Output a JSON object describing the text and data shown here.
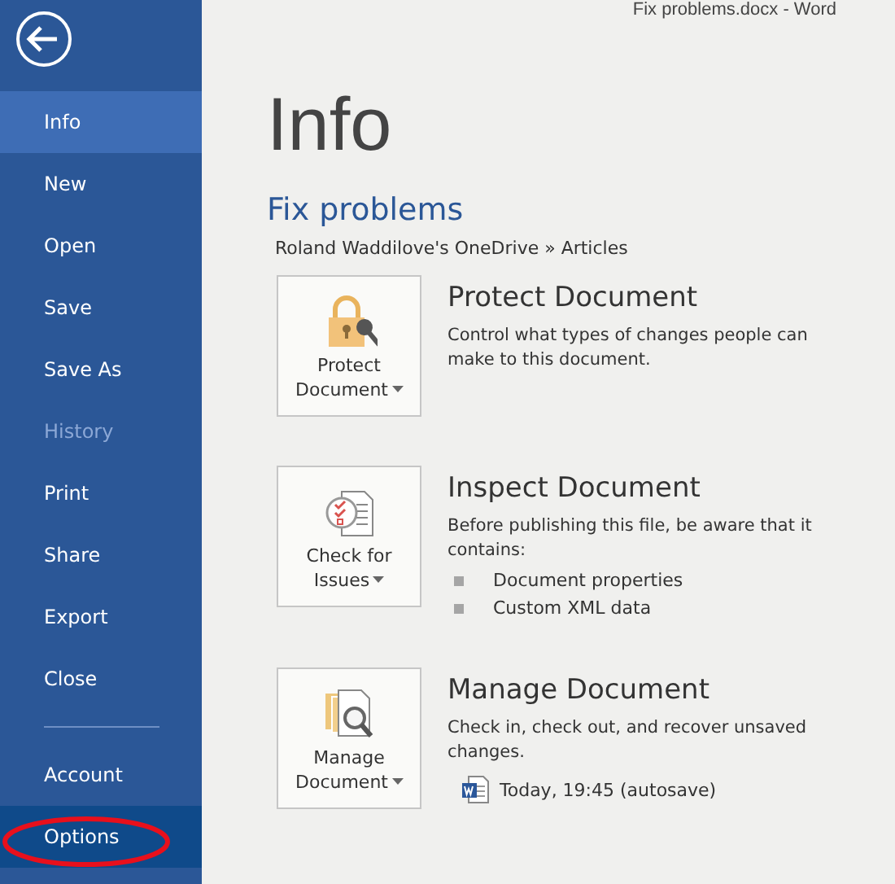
{
  "window": {
    "title": "Fix problems.docx - Word"
  },
  "sidebar": {
    "items": [
      {
        "label": "Info",
        "selected": true,
        "disabled": false,
        "hovered": false
      },
      {
        "label": "New",
        "selected": false,
        "disabled": false,
        "hovered": false
      },
      {
        "label": "Open",
        "selected": false,
        "disabled": false,
        "hovered": false
      },
      {
        "label": "Save",
        "selected": false,
        "disabled": false,
        "hovered": false
      },
      {
        "label": "Save As",
        "selected": false,
        "disabled": false,
        "hovered": false
      },
      {
        "label": "History",
        "selected": false,
        "disabled": true,
        "hovered": false
      },
      {
        "label": "Print",
        "selected": false,
        "disabled": false,
        "hovered": false
      },
      {
        "label": "Share",
        "selected": false,
        "disabled": false,
        "hovered": false
      },
      {
        "label": "Export",
        "selected": false,
        "disabled": false,
        "hovered": false
      },
      {
        "label": "Close",
        "selected": false,
        "disabled": false,
        "hovered": false
      }
    ],
    "footer_items": [
      {
        "label": "Account",
        "selected": false,
        "disabled": false,
        "hovered": false,
        "circled": false
      },
      {
        "label": "Options",
        "selected": false,
        "disabled": false,
        "hovered": true,
        "circled": true
      }
    ]
  },
  "page": {
    "heading": "Info",
    "section": "Fix problems",
    "path": "Roland Waddilove's OneDrive » Articles",
    "cards": [
      {
        "kind": "protect",
        "button": [
          "Protect",
          "Document"
        ],
        "title": "Protect Document",
        "description": "Control what types of changes people can make to this document."
      },
      {
        "kind": "inspect",
        "button": [
          "Check for",
          "Issues"
        ],
        "title": "Inspect Document",
        "description": "Before publishing this file, be aware that it contains:",
        "bullets": [
          "Document properties",
          "Custom XML data"
        ]
      },
      {
        "kind": "manage",
        "button": [
          "Manage",
          "Document"
        ],
        "title": "Manage Document",
        "description": "Check in, check out, and recover unsaved changes.",
        "versions": [
          "Today, 19:45 (autosave)"
        ]
      }
    ]
  }
}
